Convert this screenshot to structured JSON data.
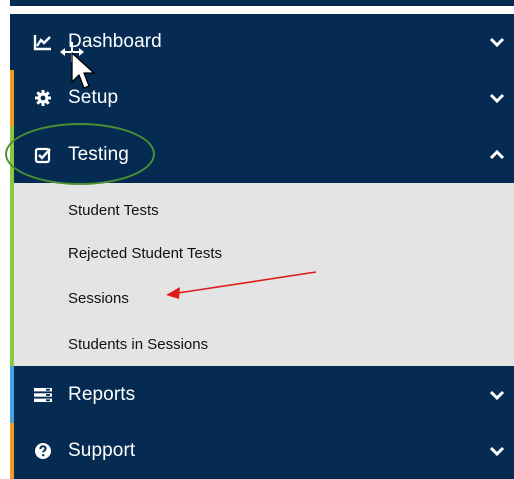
{
  "nav": {
    "items": [
      {
        "label": "Dashboard",
        "icon": "chart-line-icon",
        "expanded": false
      },
      {
        "label": "Setup",
        "icon": "gear-icon",
        "expanded": false
      },
      {
        "label": "Testing",
        "icon": "checkbox-icon",
        "expanded": true
      },
      {
        "label": "Reports",
        "icon": "list-icon",
        "expanded": false
      },
      {
        "label": "Support",
        "icon": "question-circle-icon",
        "expanded": false
      }
    ],
    "testing_submenu": [
      {
        "label": "Student Tests"
      },
      {
        "label": "Rejected Student Tests"
      },
      {
        "label": "Sessions"
      },
      {
        "label": "Students in Sessions"
      }
    ]
  },
  "colors": {
    "nav_background": "#062b52",
    "submenu_background": "#e4e4e4",
    "accent_green": "#8dc63f",
    "accent_orange": "#f29a1f",
    "accent_blue": "#4aa3df",
    "annotation_circle": "#4d8f35",
    "annotation_arrow": "#e01b1b"
  }
}
